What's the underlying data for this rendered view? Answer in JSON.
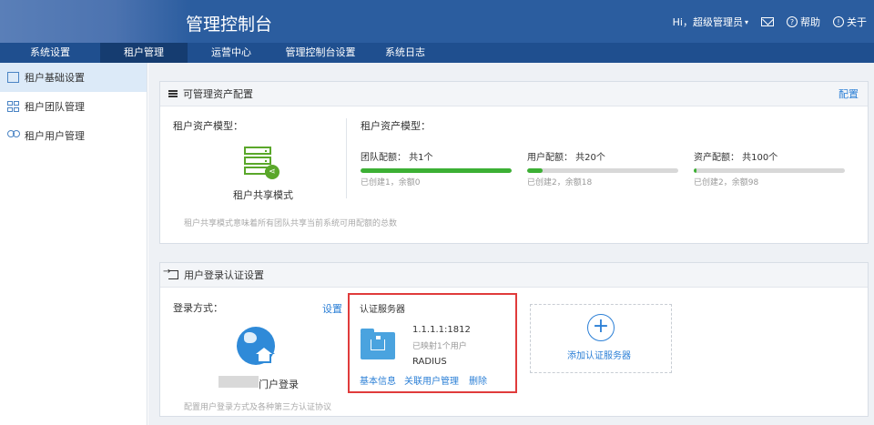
{
  "header": {
    "title": "管理控制台",
    "greeting": "Hi，超级管理员",
    "help": "帮助",
    "about": "关于"
  },
  "nav": {
    "tabs": [
      {
        "label": "系统设置",
        "active": false
      },
      {
        "label": "租户管理",
        "active": true
      },
      {
        "label": "运营中心",
        "active": false
      },
      {
        "label": "管理控制台设置",
        "active": false
      },
      {
        "label": "系统日志",
        "active": false
      }
    ]
  },
  "sidebar": {
    "items": [
      {
        "label": "租户基础设置",
        "active": true
      },
      {
        "label": "租户团队管理",
        "active": false
      },
      {
        "label": "租户用户管理",
        "active": false
      }
    ]
  },
  "asset_panel": {
    "title": "可管理资产配置",
    "config_link": "配置",
    "model_label_left": "租户资产模型：",
    "model_name": "租户共享模式",
    "model_label_right": "租户资产模型：",
    "quotas": [
      {
        "title": "团队配额：  共1个",
        "sub": "已创建1，余额0",
        "fill": 1.0
      },
      {
        "title": "用户配额：  共20个",
        "sub": "已创建2，余额18",
        "fill": 0.1
      },
      {
        "title": "资产配额：  共100个",
        "sub": "已创建2，余额98",
        "fill": 0.02
      }
    ],
    "footnote": "租户共享模式意味着所有团队共享当前系统可用配额的总数"
  },
  "auth_panel": {
    "title": "用户登录认证设置",
    "login_method_label": "登录方式：",
    "settings_link": "设置",
    "portal_label": "门户登录",
    "server_section_title": "认证服务器",
    "server": {
      "address": "1.1.1.1:1812",
      "mapped": "已映射1个用户",
      "type": "RADIUS",
      "links": [
        "基本信息",
        "关联用户管理",
        "删除"
      ]
    },
    "add_server": "添加认证服务器",
    "footnote": "配置用户登录方式及各种第三方认证协议"
  },
  "colors": {
    "header_bg": "#2b5d9f",
    "nav_bg": "#1f4f8f",
    "accent": "#2b7fd6",
    "progress": "#3cb034",
    "highlight": "#e03b3b"
  }
}
